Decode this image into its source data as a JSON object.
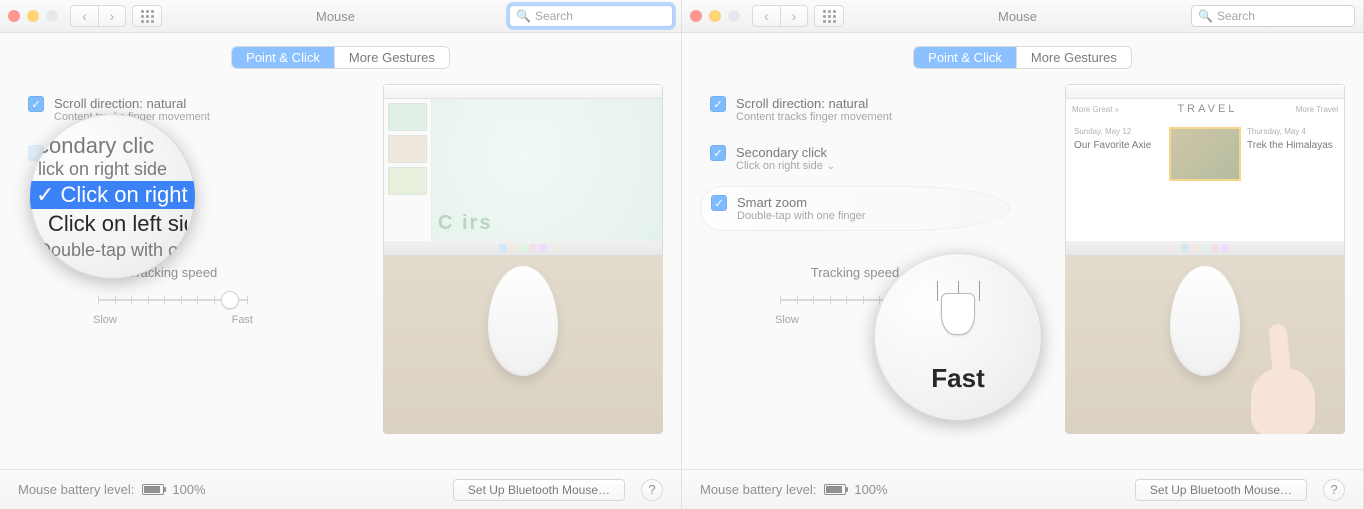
{
  "window": {
    "title": "Mouse"
  },
  "toolbar": {
    "search_placeholder": "Search"
  },
  "tabs": {
    "point_click": "Point & Click",
    "more_gestures": "More Gestures"
  },
  "options": {
    "scroll": {
      "label": "Scroll direction: natural",
      "sub": "Content tracks finger movement"
    },
    "secondary": {
      "label": "Secondary click",
      "sub": "Click on right side"
    },
    "smartzoom": {
      "label": "Smart zoom",
      "sub": "Double-tap with one finger"
    }
  },
  "dropdown": {
    "heading_line1": "condary clic",
    "heading_line2": "lick on right side",
    "option_right": "Click on right sid",
    "option_left": "Click on left side",
    "tail": "Double-tap with on"
  },
  "tracking": {
    "label": "Tracking speed",
    "slow": "Slow",
    "fast": "Fast",
    "knob_pct": 88
  },
  "footer": {
    "battery_label": "Mouse battery level:",
    "battery_value": "100%",
    "bluetooth_btn": "Set Up Bluetooth Mouse…",
    "help": "?"
  },
  "preview": {
    "travel_header": "TRAVEL",
    "left_date": "Sunday, May 12",
    "left_headline": "Our Favorite Axie",
    "mid_date": "",
    "right_date": "Thursday, May 4",
    "right_headline": "Trek the Himalayas",
    "more_left": "More Great »",
    "more_right": "More Travel"
  },
  "mag2": {
    "fast": "Fast"
  },
  "colors": {
    "accent": "#3b99fc"
  }
}
